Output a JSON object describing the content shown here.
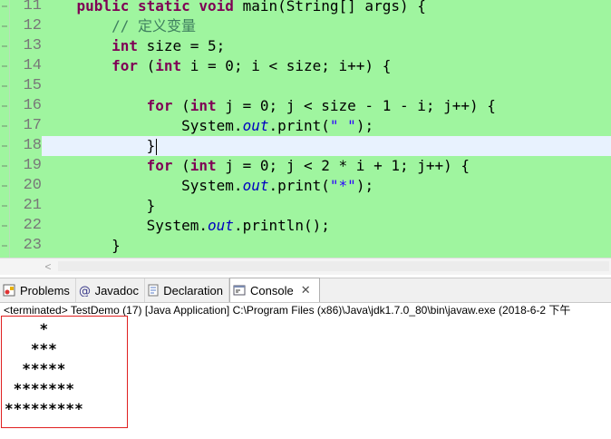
{
  "editor": {
    "lines": [
      {
        "no": "11",
        "tokens": [
          {
            "t": "    "
          },
          {
            "t": "public",
            "c": "kw"
          },
          {
            "t": " "
          },
          {
            "t": "static",
            "c": "kw"
          },
          {
            "t": " "
          },
          {
            "t": "void",
            "c": "kw"
          },
          {
            "t": " main(String[] args) {"
          }
        ]
      },
      {
        "no": "12",
        "tokens": [
          {
            "t": "        "
          },
          {
            "t": "// 定义变量",
            "c": "cmt"
          }
        ]
      },
      {
        "no": "13",
        "tokens": [
          {
            "t": "        "
          },
          {
            "t": "int",
            "c": "kw"
          },
          {
            "t": " size = 5;"
          }
        ]
      },
      {
        "no": "14",
        "tokens": [
          {
            "t": "        "
          },
          {
            "t": "for",
            "c": "kw"
          },
          {
            "t": " ("
          },
          {
            "t": "int",
            "c": "kw"
          },
          {
            "t": " i = 0; i < size; i++) {"
          }
        ]
      },
      {
        "no": "15",
        "tokens": [
          {
            "t": ""
          }
        ]
      },
      {
        "no": "16",
        "tokens": [
          {
            "t": "            "
          },
          {
            "t": "for",
            "c": "kw"
          },
          {
            "t": " ("
          },
          {
            "t": "int",
            "c": "kw"
          },
          {
            "t": " j = 0; j < size - 1 - i; j++) {"
          }
        ]
      },
      {
        "no": "17",
        "tokens": [
          {
            "t": "                System."
          },
          {
            "t": "out",
            "c": "fld"
          },
          {
            "t": ".print("
          },
          {
            "t": "\" \"",
            "c": "str"
          },
          {
            "t": ");"
          }
        ]
      },
      {
        "no": "18",
        "tokens": [
          {
            "t": "            }"
          }
        ],
        "current": true,
        "caret": true
      },
      {
        "no": "19",
        "tokens": [
          {
            "t": "            "
          },
          {
            "t": "for",
            "c": "kw"
          },
          {
            "t": " ("
          },
          {
            "t": "int",
            "c": "kw"
          },
          {
            "t": " j = 0; j < 2 * i + 1; j++) {"
          }
        ]
      },
      {
        "no": "20",
        "tokens": [
          {
            "t": "                System."
          },
          {
            "t": "out",
            "c": "fld"
          },
          {
            "t": ".print("
          },
          {
            "t": "\"*\"",
            "c": "str"
          },
          {
            "t": ");"
          }
        ]
      },
      {
        "no": "21",
        "tokens": [
          {
            "t": "            }"
          }
        ]
      },
      {
        "no": "22",
        "tokens": [
          {
            "t": "            System."
          },
          {
            "t": "out",
            "c": "fld"
          },
          {
            "t": ".println();"
          }
        ]
      },
      {
        "no": "23",
        "tokens": [
          {
            "t": "        }"
          }
        ]
      }
    ]
  },
  "scrollbar": {
    "left_arrow": "<"
  },
  "tabs": [
    {
      "name": "problems",
      "label": "Problems",
      "icon": "problems-icon"
    },
    {
      "name": "javadoc",
      "label": "Javadoc",
      "icon": "at-sign-icon"
    },
    {
      "name": "declaration",
      "label": "Declaration",
      "icon": "declaration-icon"
    },
    {
      "name": "console",
      "label": "Console",
      "icon": "console-icon",
      "active": true,
      "closable": true
    }
  ],
  "console": {
    "status": "<terminated> TestDemo (17) [Java Application] C:\\Program Files (x86)\\Java\\jdk1.7.0_80\\bin\\javaw.exe (2018-6-2 下午",
    "output": [
      "    *",
      "   ***",
      "  *****",
      " *******",
      "*********"
    ]
  },
  "colors": {
    "editor_bg": "#9ff59f",
    "current_line": "#e8f2fe",
    "keyword": "#7f0055",
    "string": "#2a00ff",
    "field": "#0000c0",
    "comment": "#3f7f5f",
    "highlight_box": "#e02020"
  }
}
